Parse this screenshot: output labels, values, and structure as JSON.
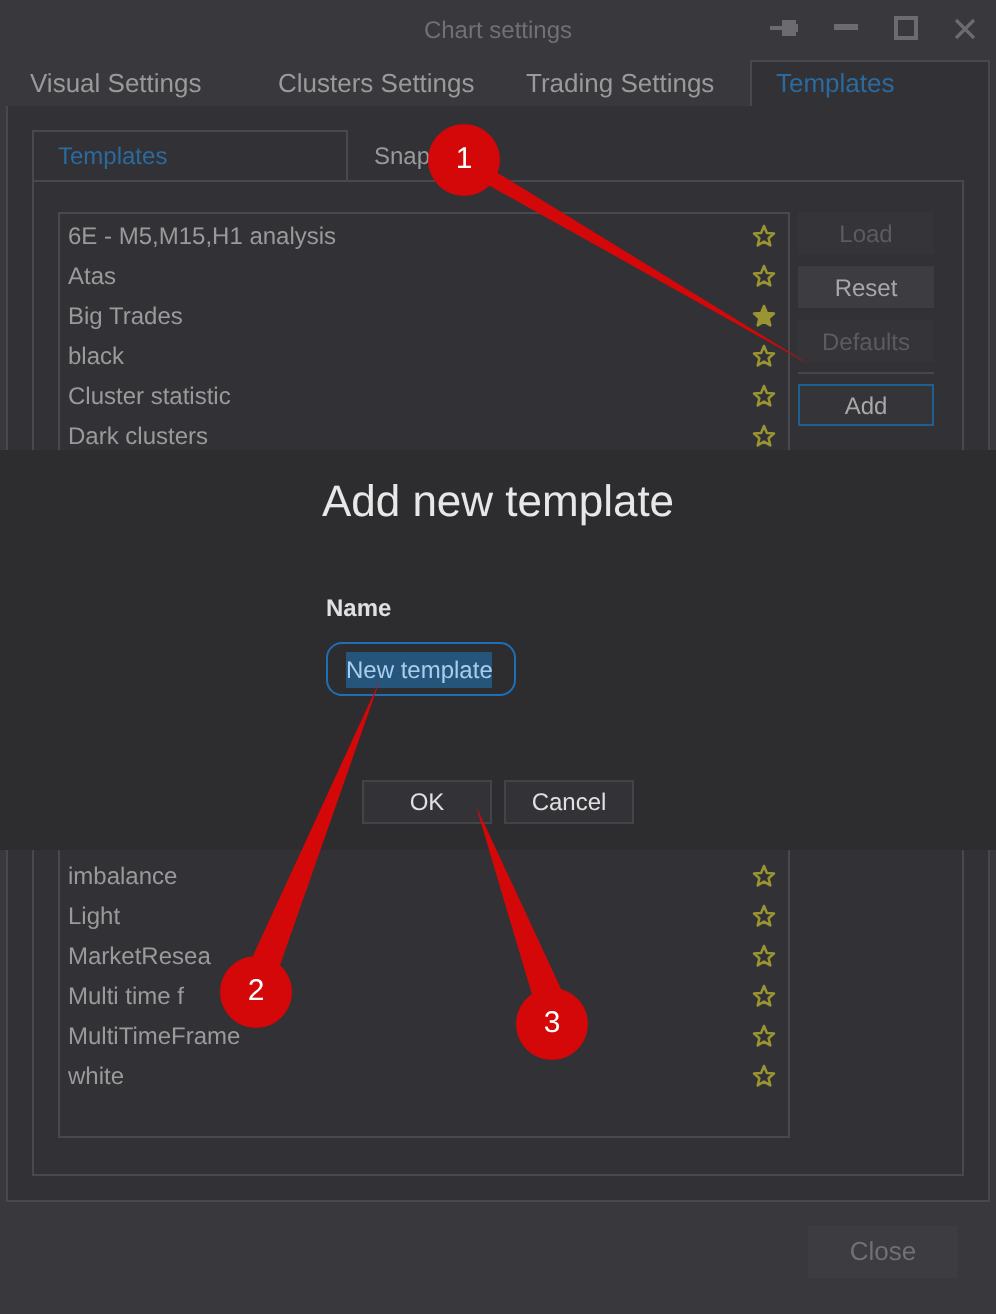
{
  "window": {
    "title": "Chart settings"
  },
  "tabs": [
    {
      "label": "Visual Settings",
      "selected": false
    },
    {
      "label": "Clusters Settings",
      "selected": false
    },
    {
      "label": "Trading Settings",
      "selected": false
    },
    {
      "label": "Templates",
      "selected": true
    }
  ],
  "subtabs": [
    {
      "label": "Templates",
      "selected": true
    },
    {
      "label": "Snap",
      "selected": false
    }
  ],
  "templates_above_dialog": [
    {
      "name": "6E - M5,M15,H1 analysis",
      "favorite": false
    },
    {
      "name": "Atas",
      "favorite": false
    },
    {
      "name": "Big Trades",
      "favorite": true
    },
    {
      "name": "black",
      "favorite": false
    },
    {
      "name": "Cluster statistic",
      "favorite": false
    },
    {
      "name": "Dark clusters",
      "favorite": false
    }
  ],
  "templates_below_dialog": [
    {
      "name": "imbalance",
      "favorite": false
    },
    {
      "name": "Light",
      "favorite": false
    },
    {
      "name": "MarketResea",
      "favorite": false
    },
    {
      "name": "Multi time f",
      "favorite": false
    },
    {
      "name": "MultiTimeFrame",
      "favorite": false
    },
    {
      "name": "white",
      "favorite": false
    }
  ],
  "side_buttons": [
    {
      "label": "Load",
      "disabled": true,
      "focused": false
    },
    {
      "label": "Reset",
      "disabled": false,
      "focused": false
    },
    {
      "label": "Defaults",
      "disabled": true,
      "focused": false
    },
    {
      "label": "Add",
      "disabled": false,
      "focused": true
    }
  ],
  "dialog": {
    "title": "Add new template",
    "field_label": "Name",
    "value": "New template",
    "buttons": [
      "OK",
      "Cancel"
    ]
  },
  "close_button": "Close",
  "annotations": [
    "1",
    "2",
    "3"
  ]
}
